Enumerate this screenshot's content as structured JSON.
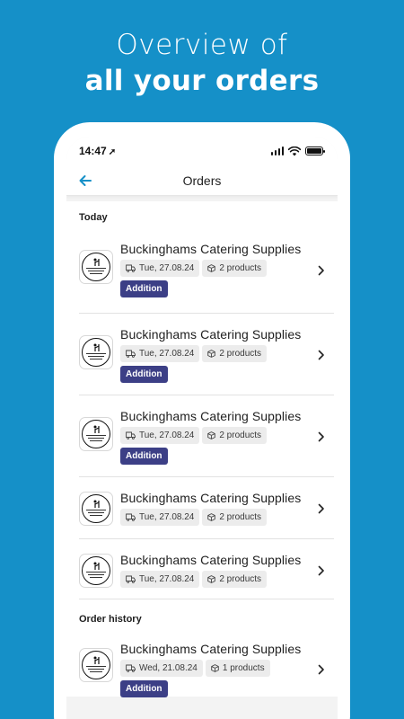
{
  "headline": {
    "line1": "Overview of",
    "line2": "all your orders"
  },
  "status_bar": {
    "time": "14:47",
    "location_glyph": "➚"
  },
  "nav": {
    "title": "Orders",
    "back_icon": "arrow-left-icon"
  },
  "sections": {
    "today": "Today",
    "history": "Order history"
  },
  "orders": [
    {
      "supplier": "Buckinghams Catering Supplies",
      "date": "Tue, 27.08.24",
      "products": "2 products",
      "badge": "Addition"
    },
    {
      "supplier": "Buckinghams Catering Supplies",
      "date": "Tue, 27.08.24",
      "products": "2 products",
      "badge": "Addition"
    },
    {
      "supplier": "Buckinghams Catering Supplies",
      "date": "Tue, 27.08.24",
      "products": "2 products",
      "badge": "Addition"
    },
    {
      "supplier": "Buckinghams Catering Supplies",
      "date": "Tue, 27.08.24",
      "products": "2 products",
      "badge": ""
    },
    {
      "supplier": "Buckinghams Catering Supplies",
      "date": "Tue, 27.08.24",
      "products": "2 products",
      "badge": ""
    },
    {
      "supplier": "Buckinghams Catering Supplies",
      "date": "Wed, 21.08.24",
      "products": "1 products",
      "badge": "Addition"
    }
  ],
  "colors": {
    "background": "#1590c8",
    "accent": "#1590c8",
    "badge": "#3c3f86",
    "chip": "#ececec"
  }
}
